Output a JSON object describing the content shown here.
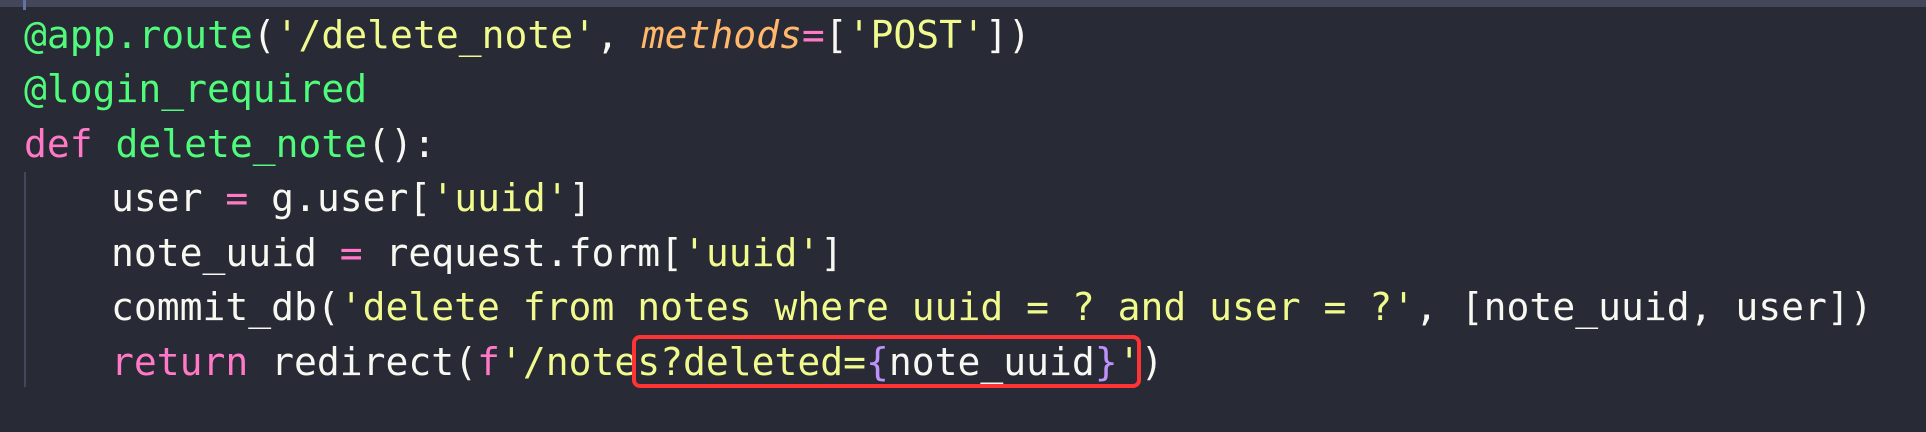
{
  "code": {
    "line1": {
      "decorator": "@app.route",
      "open_paren": "(",
      "route_string": "'/delete_note'",
      "comma": ", ",
      "kwarg": "methods",
      "equals": "=",
      "open_bracket": "[",
      "method_string": "'POST'",
      "close": "])"
    },
    "line2": {
      "decorator": "@login_required"
    },
    "line3": {
      "keyword": "def",
      "space": " ",
      "func_name": "delete_note",
      "signature": "():"
    },
    "line4": {
      "var": "user ",
      "op": "=",
      "rest": " g.user[",
      "key": "'uuid'",
      "close": "]"
    },
    "line5": {
      "var": "note_uuid ",
      "op": "=",
      "rest": " request.form[",
      "key": "'uuid'",
      "close": "]"
    },
    "line6": {
      "call": "commit_db(",
      "sql": "'delete from notes where uuid = ? and user = ?'",
      "rest": ", [note_uuid, user])"
    },
    "line7": {
      "keyword": "return",
      "call": " redirect(",
      "fprefix": "f",
      "str_start": "'/notes?deleted=",
      "brace_open": "{",
      "expr": "note_uuid",
      "brace_close": "}",
      "str_end": "'",
      "close": ")"
    }
  },
  "colors": {
    "background": "#282a36",
    "decorator": "#50fa7b",
    "keyword": "#ff79c6",
    "string": "#f1fa8c",
    "kwarg": "#ffb86c",
    "brace": "#bd93f9",
    "highlight_border": "#ff3333"
  }
}
